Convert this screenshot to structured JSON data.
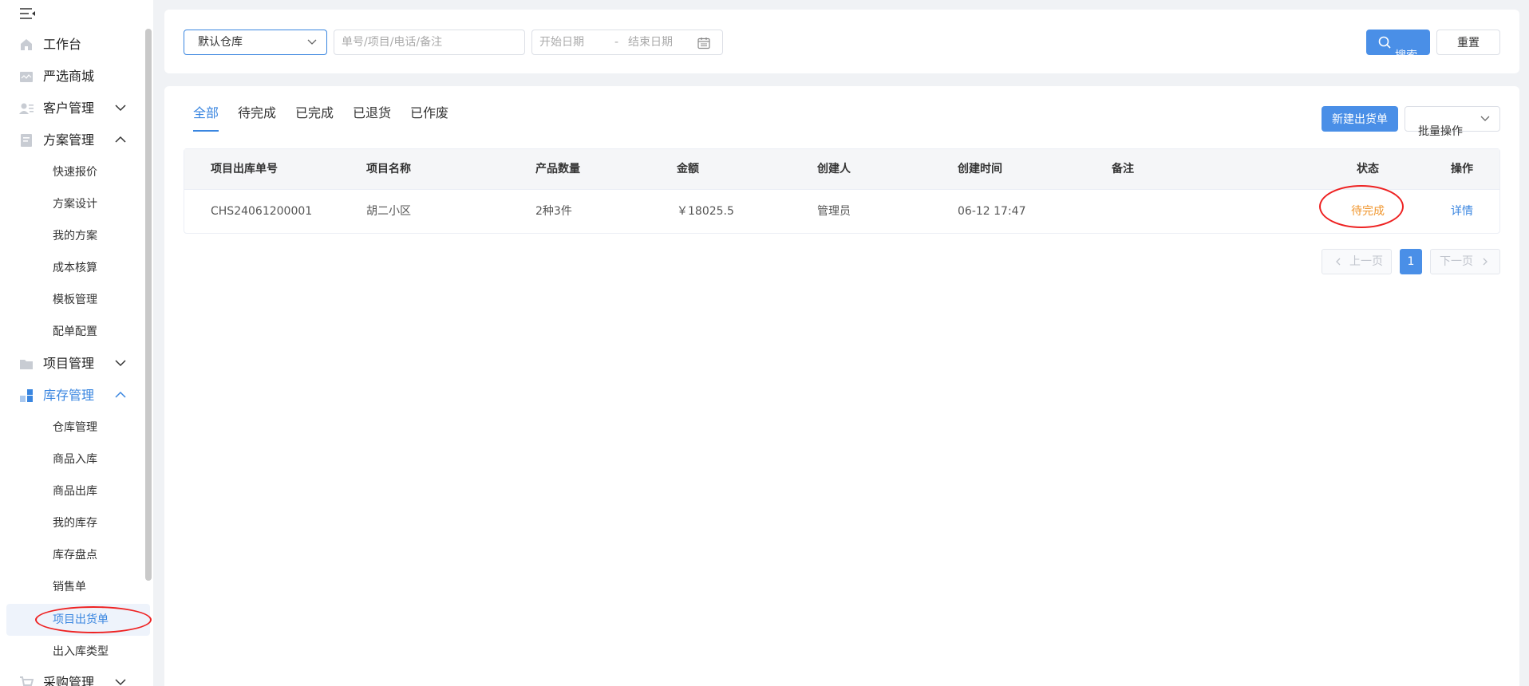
{
  "sidebar": {
    "items": [
      {
        "label": "工作台",
        "icon": "home-icon"
      },
      {
        "label": "严选商城",
        "icon": "store-icon"
      },
      {
        "label": "客户管理",
        "icon": "customer-icon",
        "expanded": false
      },
      {
        "label": "方案管理",
        "icon": "document-icon",
        "expanded": true
      },
      {
        "label": "项目管理",
        "icon": "folder-icon",
        "expanded": false
      },
      {
        "label": "库存管理",
        "icon": "inventory-icon",
        "expanded": true,
        "active": true
      },
      {
        "label": "采购管理",
        "icon": "cart-icon",
        "expanded": false
      }
    ],
    "plan_sub": [
      "快速报价",
      "方案设计",
      "我的方案",
      "成本核算",
      "模板管理",
      "配单配置"
    ],
    "inventory_sub": [
      "仓库管理",
      "商品入库",
      "商品出库",
      "我的库存",
      "库存盘点",
      "销售单",
      "项目出货单",
      "出入库类型"
    ],
    "selected_sub": "项目出货单"
  },
  "search": {
    "warehouse": "默认仓库",
    "keyword_placeholder": "单号/项目/电话/备注",
    "start_date_placeholder": "开始日期",
    "date_separator": "-",
    "end_date_placeholder": "结束日期",
    "search_label": "搜索",
    "reset_label": "重置"
  },
  "tabs": [
    "全部",
    "待完成",
    "已完成",
    "已退货",
    "已作废"
  ],
  "active_tab": "全部",
  "actions": {
    "new_label": "新建出货单",
    "batch_label": "批量操作"
  },
  "table": {
    "headers": [
      "项目出库单号",
      "项目名称",
      "产品数量",
      "金额",
      "创建人",
      "创建时间",
      "备注",
      "状态",
      "操作"
    ],
    "rows": [
      {
        "order_no": "CHS24061200001",
        "project": "胡二小区",
        "quantity": "2种3件",
        "amount": "￥18025.5",
        "creator": "管理员",
        "created_at": "06-12 17:47",
        "remark": "",
        "status": "待完成",
        "action": "详情"
      }
    ]
  },
  "pagination": {
    "prev_label": "上一页",
    "next_label": "下一页",
    "current_page": "1"
  },
  "colors": {
    "accent": "#3a86e0",
    "primary_button": "#4a8fe7",
    "status_pending": "#f0962d",
    "annotation": "#e22222"
  }
}
